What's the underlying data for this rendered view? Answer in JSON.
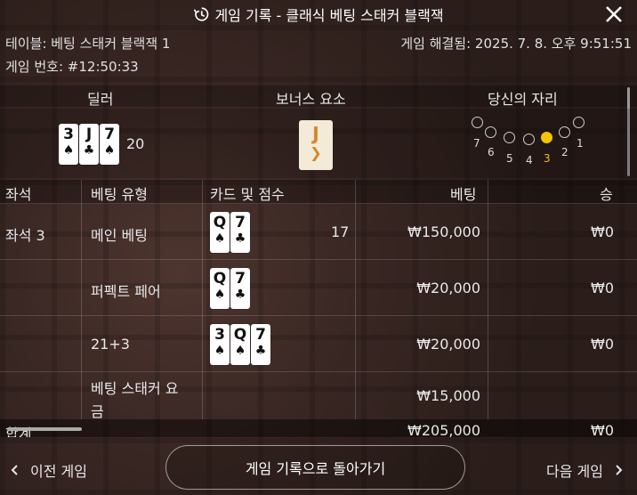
{
  "header": {
    "title": "게임 기록 - 클래식 베팅 스태커 블랙잭"
  },
  "info": {
    "table_label": "테이블: 베팅 스태커 블랙잭 1",
    "resolved_label": "게임 해결됨: 2025. 7. 8. 오후 9:51:51",
    "game_number": "게임 번호: #12:50:33"
  },
  "sections": {
    "dealer": "딜러",
    "bonus": "보너스 요소",
    "seat": "당신의 자리"
  },
  "dealer": {
    "cards": [
      {
        "rank": "3",
        "suit": "♠"
      },
      {
        "rank": "J",
        "suit": "♣"
      },
      {
        "rank": "7",
        "suit": "♠"
      }
    ],
    "score": "20"
  },
  "bonus_card": {
    "rank": "J",
    "symbol": "❯"
  },
  "seats": {
    "labels": [
      "7",
      "6",
      "5",
      "4",
      "3",
      "2",
      "1"
    ],
    "selected": "3"
  },
  "table": {
    "headers": [
      "좌석",
      "베팅 유형",
      "카드 및 점수",
      "베팅",
      "승"
    ],
    "rows": [
      {
        "seat": "좌석 3",
        "type": "메인 베팅",
        "cards": [
          {
            "rank": "Q",
            "suit": "♠"
          },
          {
            "rank": "7",
            "suit": "♣"
          }
        ],
        "score": "17",
        "bet": "₩150,000",
        "win": "₩0"
      },
      {
        "seat": "",
        "type": "퍼펙트 페어",
        "cards": [
          {
            "rank": "Q",
            "suit": "♠"
          },
          {
            "rank": "7",
            "suit": "♣"
          }
        ],
        "score": "",
        "bet": "₩20,000",
        "win": "₩0"
      },
      {
        "seat": "",
        "type": "21+3",
        "cards": [
          {
            "rank": "3",
            "suit": "♠"
          },
          {
            "rank": "Q",
            "suit": "♠"
          },
          {
            "rank": "7",
            "suit": "♣"
          }
        ],
        "score": "",
        "bet": "₩20,000",
        "win": "₩0"
      },
      {
        "seat": "",
        "type_line1": "베팅 스태커 요",
        "type_line2": "금",
        "cards": [],
        "score": "",
        "bet": "₩15,000",
        "win": ""
      }
    ],
    "total": {
      "label": "합계",
      "bet": "₩205,000",
      "win": "₩0"
    }
  },
  "footer": {
    "prev": "이전 게임",
    "back": "게임 기록으로 돌아가기",
    "next": "다음 게임"
  },
  "colors": {
    "accent": "#f4c400",
    "bonus": "#d2872a"
  }
}
